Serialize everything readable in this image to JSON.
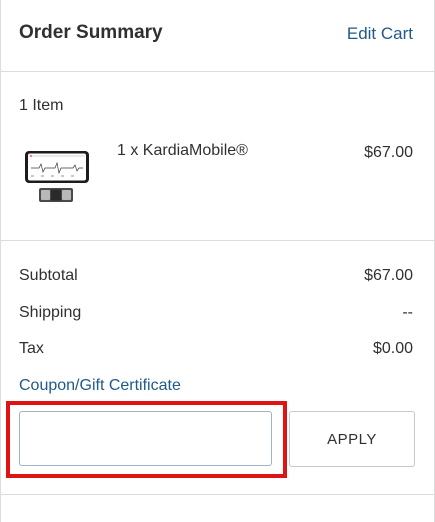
{
  "header": {
    "title": "Order Summary",
    "edit_cart_label": "Edit Cart"
  },
  "items": {
    "count_label": "1 Item",
    "list": [
      {
        "name": "1 x KardiaMobile®",
        "price": "$67.00",
        "image_icon": "kardiamobile-product-image"
      }
    ]
  },
  "totals": {
    "subtotal_label": "Subtotal",
    "subtotal_value": "$67.00",
    "shipping_label": "Shipping",
    "shipping_value": "--",
    "tax_label": "Tax",
    "tax_value": "$0.00"
  },
  "coupon": {
    "link_label": "Coupon/Gift Certificate",
    "input_value": "",
    "apply_label": "APPLY"
  },
  "colors": {
    "link": "#1f5a8a",
    "highlight": "#e01313",
    "text": "#303030"
  }
}
